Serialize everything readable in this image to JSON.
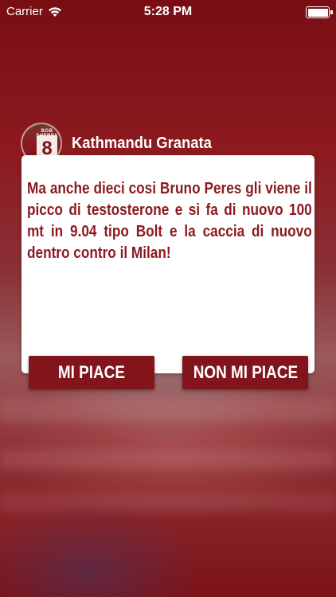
{
  "status_bar": {
    "carrier": "Carrier",
    "time": "5:28 PM",
    "wifi_icon": "wifi-icon",
    "battery_icon": "battery-icon"
  },
  "post": {
    "author": "Kathmandu Granata",
    "avatar": {
      "jersey_name": "BOB SHERPA",
      "jersey_number": "8"
    },
    "message": "Ma anche dieci cosi Bruno Peres gli viene il picco di testosterone e si fa di nuovo 100 mt in 9.04 tipo Bolt e la caccia di nuovo dentro contro il Milan!"
  },
  "actions": {
    "like_label": "MI PIACE",
    "dislike_label": "NON MI PIACE"
  },
  "colors": {
    "accent": "#82141b",
    "text_accent": "#8b1a1f"
  }
}
